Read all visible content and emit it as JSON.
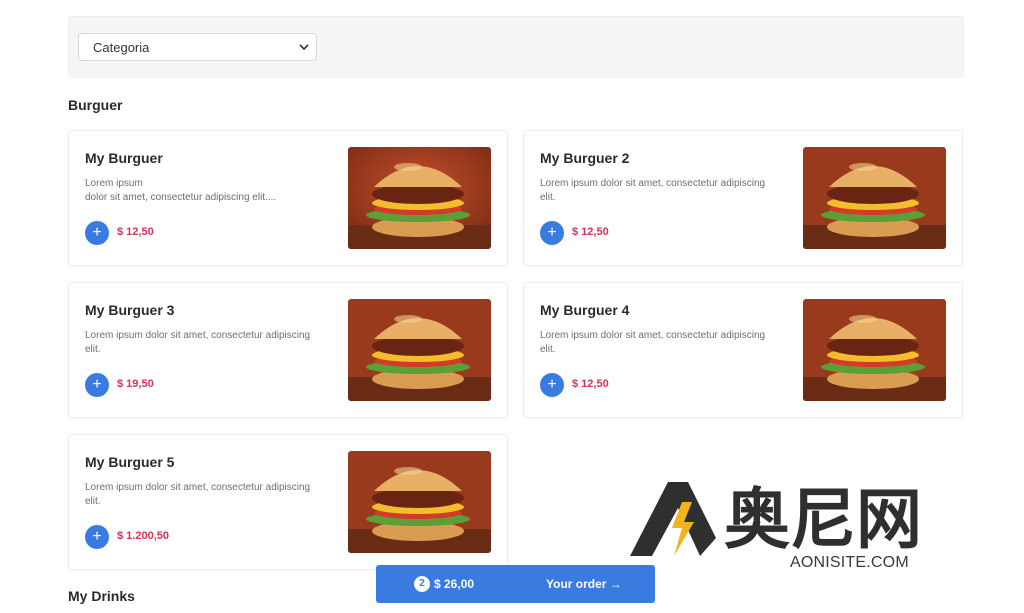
{
  "filter": {
    "category_select": "Categoria"
  },
  "sections": {
    "burguer_title": "Burguer",
    "drinks_title": "My Drinks"
  },
  "products": [
    {
      "name": "My Burguer",
      "description": "Lorem ipsum\ndolor sit amet, consectetur adipiscing elit....",
      "price": "$ 12,50"
    },
    {
      "name": "My Burguer 2",
      "description": "Lorem ipsum dolor sit amet, consectetur adipiscing elit.",
      "price": "$ 12,50"
    },
    {
      "name": "My Burguer 3",
      "description": "Lorem ipsum dolor sit amet, consectetur adipiscing elit.",
      "price": "$ 19,50"
    },
    {
      "name": "My Burguer 4",
      "description": "Lorem ipsum dolor sit amet, consectetur adipiscing elit.",
      "price": "$ 12,50"
    },
    {
      "name": "My Burguer 5",
      "description": "Lorem ipsum dolor sit amet, consectetur adipiscing elit.",
      "price": "$ 1.200,50"
    }
  ],
  "add_button_icon": "plus-icon",
  "order": {
    "count": "2",
    "total": "$ 26,00",
    "cta": "Your order →"
  },
  "watermark": {
    "logo": "奥尼网",
    "site": "AONISITE.COM"
  },
  "colors": {
    "accent": "#3a7be0",
    "price": "#d7324e"
  }
}
